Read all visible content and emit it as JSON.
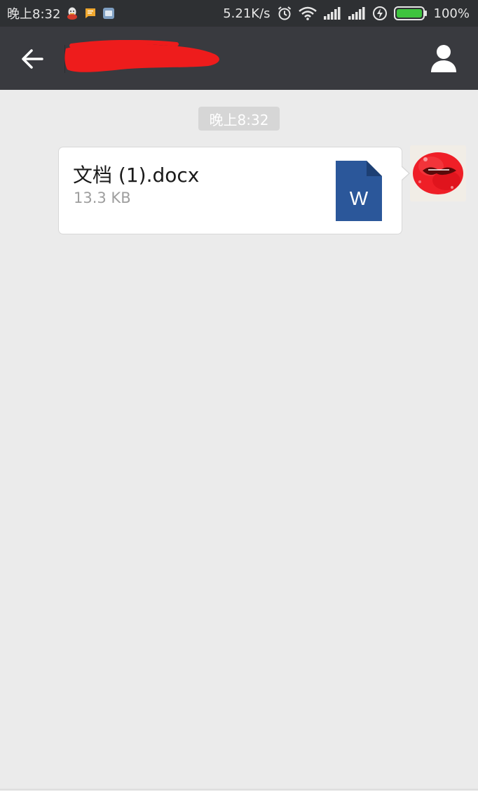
{
  "status_bar": {
    "time": "晚上8:32",
    "network_speed": "5.21K/s",
    "battery": "100%",
    "icons": [
      "qq-icon",
      "message-icon",
      "app-icon",
      "alarm-icon",
      "wifi-icon",
      "signal-icon",
      "signal-icon",
      "charging-icon",
      "battery-icon"
    ]
  },
  "title_bar": {
    "contact_name": "",
    "back_icon": "arrow-left-icon",
    "profile_icon": "person-icon"
  },
  "chat": {
    "timestamp": "晚上8:32",
    "messages": [
      {
        "type": "file",
        "file_name": "文档 (1).docx",
        "file_size": "13.3 KB",
        "file_icon": "word-document-icon",
        "file_icon_letter": "W",
        "file_icon_color": "#2b579a"
      }
    ]
  },
  "colors": {
    "status_bar_bg": "#2e3033",
    "title_bar_bg": "#393a3f",
    "chat_bg": "#ebebeb",
    "redaction": "#ee1c1c",
    "battery_green": "#3ec43e"
  }
}
